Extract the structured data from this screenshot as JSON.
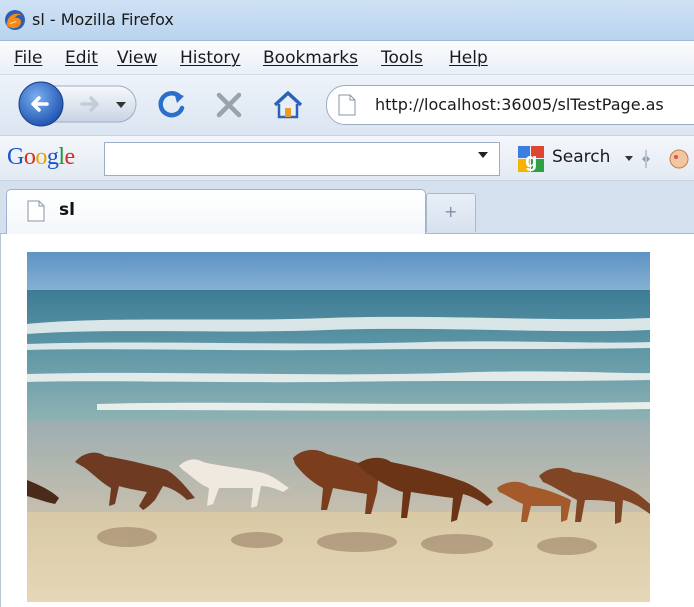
{
  "window": {
    "title": "sl - Mozilla Firefox"
  },
  "menu": {
    "items": [
      "File",
      "Edit",
      "View",
      "History",
      "Bookmarks",
      "Tools",
      "Help"
    ]
  },
  "navigation": {
    "back_icon": "back-arrow-icon",
    "forward_icon": "forward-arrow-icon",
    "refresh_icon": "refresh-icon",
    "stop_icon": "stop-icon",
    "home_icon": "home-icon",
    "url": "http://localhost:36005/slTestPage.as"
  },
  "search": {
    "engine_logo": "Google",
    "query": "",
    "button_label": "Search"
  },
  "tabs": [
    {
      "label": "sl",
      "active": true
    }
  ],
  "new_tab_label": "+",
  "colors": {
    "titlebar": "#cfe2f5",
    "back_button": "#2f6fd0",
    "refresh": "#2a6fc9",
    "stop": "#9aa3ad",
    "home": "#2a63b8"
  }
}
